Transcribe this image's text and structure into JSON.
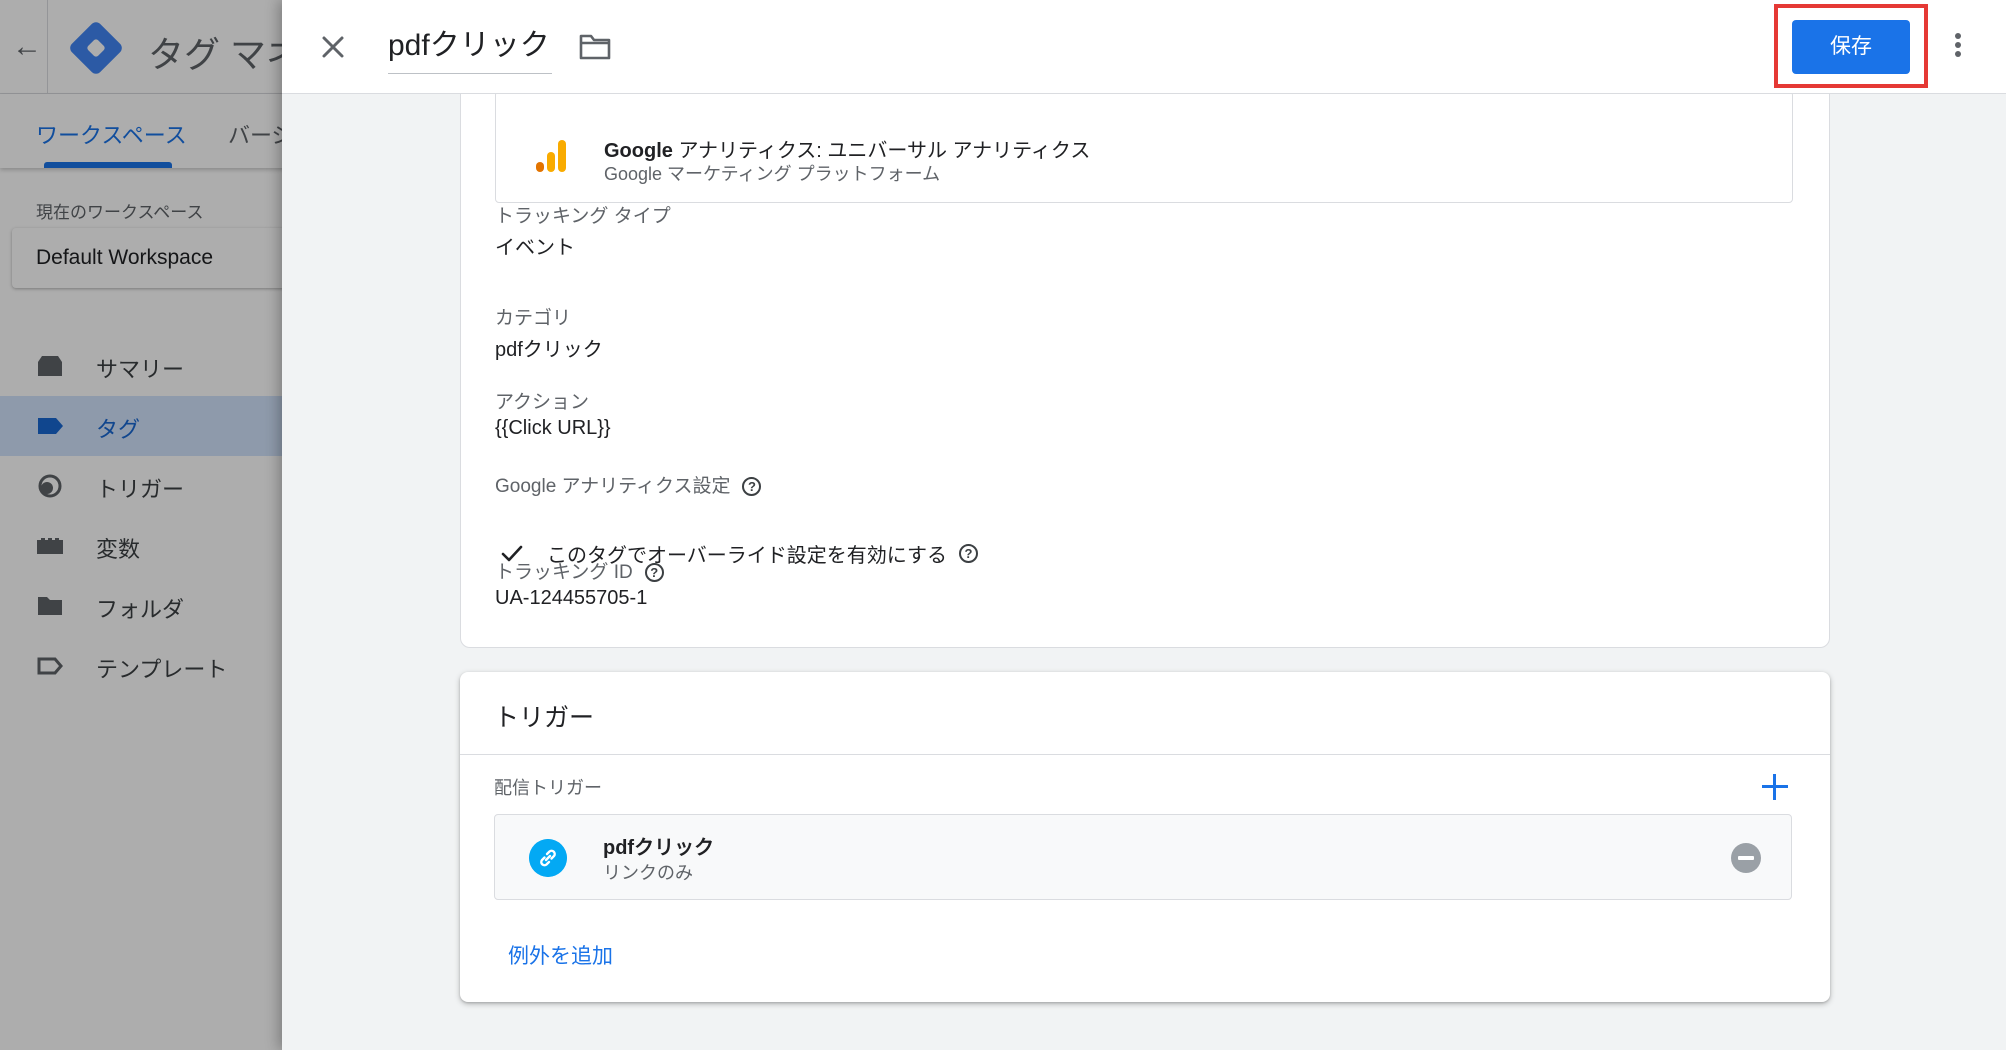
{
  "background": {
    "app_title": "タグ マネ",
    "tabs": [
      "ワークスペース",
      "バージ"
    ],
    "workspace_label": "現在のワークスペース",
    "workspace_name": "Default Workspace",
    "nav": [
      {
        "label": "サマリー",
        "icon": "summary-icon"
      },
      {
        "label": "タグ",
        "icon": "tag-icon"
      },
      {
        "label": "トリガー",
        "icon": "trigger-icon"
      },
      {
        "label": "変数",
        "icon": "variables-icon"
      },
      {
        "label": "フォルダ",
        "icon": "folder-icon"
      },
      {
        "label": "テンプレート",
        "icon": "template-icon"
      }
    ]
  },
  "drawer": {
    "title": "pdfクリック",
    "save_label": "保存"
  },
  "tag_config": {
    "tag_type_name": "Google",
    "tag_type_name_rest": " アナリティクス: ユニバーサル アナリティクス",
    "tag_type_sub": "Google マーケティング プラットフォーム",
    "tracking_type_label": "トラッキング タイプ",
    "tracking_type_value": "イベント",
    "category_label": "カテゴリ",
    "category_value": "pdfクリック",
    "action_label": "アクション",
    "action_value": "{{Click URL}}",
    "ga_settings_label": "Google アナリティクス設定",
    "override_label": "このタグでオーバーライド設定を有効にする",
    "tracking_id_label": "トラッキング ID",
    "tracking_id_value": "UA-124455705-1"
  },
  "triggering": {
    "title": "トリガー",
    "firing_label": "配信トリガー",
    "trigger_name": "pdfクリック",
    "trigger_type": "リンクのみ",
    "add_exception": "例外を追加"
  },
  "colors": {
    "accent": "#1a73e8",
    "highlight": "#e53935",
    "ga_orange": "#f9ab00",
    "ga_dark_orange": "#e37400",
    "link_blue": "#03a9f4"
  }
}
